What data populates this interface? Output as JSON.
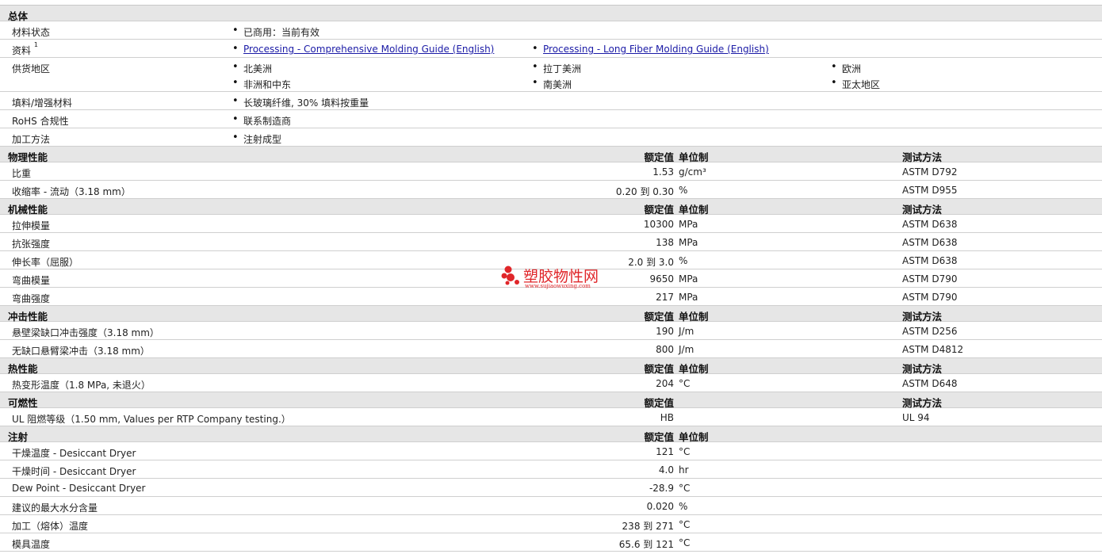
{
  "general": {
    "title": "总体",
    "material_status": {
      "label": "材料状态",
      "value": "已商用：当前有效"
    },
    "literature": {
      "label": "资料",
      "sup": "1",
      "links": [
        "Processing - Comprehensive Molding Guide (English)",
        "Processing - Long Fiber Molding Guide (English)"
      ]
    },
    "supply": {
      "label": "供货地区",
      "regions": [
        "北美洲",
        "拉丁美洲",
        "欧洲",
        "非洲和中东",
        "南美洲",
        "亚太地区"
      ]
    },
    "filler": {
      "label": "填料/增强材料",
      "value": "长玻璃纤维, 30% 填料按重量"
    },
    "rohs": {
      "label": "RoHS 合规性",
      "value": "联系制造商"
    },
    "processing": {
      "label": "加工方法",
      "value": "注射成型"
    }
  },
  "headers": {
    "value": "额定值",
    "unit": "单位制",
    "test": "测试方法"
  },
  "physical": {
    "title": "物理性能",
    "rows": [
      {
        "name": "比重",
        "value": "1.53",
        "unit": "g/cm³",
        "test": "ASTM D792"
      },
      {
        "name": "收缩率  - 流动（3.18 mm）",
        "value": "0.20 到  0.30",
        "unit": "%",
        "test": "ASTM D955"
      }
    ]
  },
  "mechanical": {
    "title": "机械性能",
    "rows": [
      {
        "name": "拉伸模量",
        "value": "10300",
        "unit": "MPa",
        "test": "ASTM D638"
      },
      {
        "name": "抗张强度",
        "value": "138",
        "unit": "MPa",
        "test": "ASTM D638"
      },
      {
        "name": "伸长率（屈服）",
        "value": "2.0 到  3.0",
        "unit": "%",
        "test": "ASTM D638"
      },
      {
        "name": "弯曲模量",
        "value": "9650",
        "unit": "MPa",
        "test": "ASTM D790"
      },
      {
        "name": "弯曲强度",
        "value": "217",
        "unit": "MPa",
        "test": "ASTM D790"
      }
    ]
  },
  "impact": {
    "title": "冲击性能",
    "rows": [
      {
        "name": "悬壁梁缺口冲击强度（3.18 mm）",
        "value": "190",
        "unit": "J/m",
        "test": "ASTM D256"
      },
      {
        "name": "无缺口悬臂梁冲击（3.18 mm）",
        "value": "800",
        "unit": "J/m",
        "test": "ASTM D4812"
      }
    ]
  },
  "thermal": {
    "title": "热性能",
    "rows": [
      {
        "name": "热变形温度（1.8 MPa, 未退火）",
        "value": "204",
        "unit": "°C",
        "test": "ASTM D648"
      }
    ]
  },
  "flammability": {
    "title": "可燃性",
    "rows": [
      {
        "name": "UL 阻燃等级（1.50 mm, Values per RTP Company testing.）",
        "value": "HB",
        "unit": "",
        "test": "UL 94"
      }
    ]
  },
  "injection": {
    "title": "注射",
    "rows": [
      {
        "name": "干燥温度  - Desiccant Dryer",
        "value": "121",
        "unit": "°C"
      },
      {
        "name": "干燥时间  - Desiccant Dryer",
        "value": "4.0",
        "unit": "hr"
      },
      {
        "name": "Dew Point - Desiccant Dryer",
        "value": "-28.9",
        "unit": "°C"
      },
      {
        "name": "建议的最大水分含量",
        "value": "0.020",
        "unit": "%"
      },
      {
        "name": "加工（熔体）温度",
        "value": "238 到  271",
        "unit": "°C"
      },
      {
        "name": "模具温度",
        "value": "65.6 到  121",
        "unit": "°C"
      }
    ]
  },
  "watermark": {
    "text": "塑胶物性网",
    "url": "www.sujiaowuxing.com",
    "color": "#e0262a"
  }
}
